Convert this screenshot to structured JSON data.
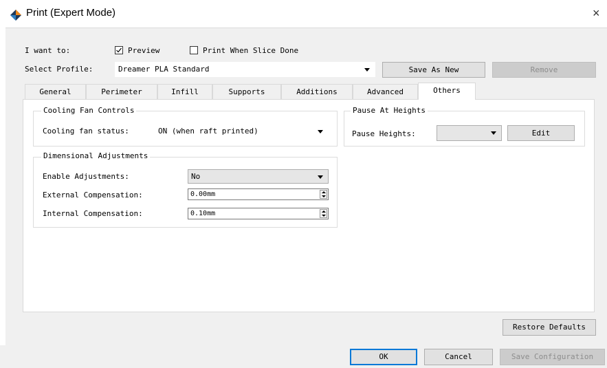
{
  "window": {
    "title": "Print (Expert Mode)",
    "close_glyph": "×",
    "icon": "diamond-logo-icon"
  },
  "top": {
    "i_want_to_label": "I want to:",
    "preview_label": "Preview",
    "preview_checked": true,
    "print_when_slice_done_label": "Print When Slice Done",
    "print_when_slice_done_checked": false
  },
  "profile": {
    "label": "Select Profile:",
    "value": "Dreamer PLA Standard",
    "save_as_new_label": "Save As New",
    "remove_label": "Remove"
  },
  "tabs": [
    {
      "label": "General",
      "active": false
    },
    {
      "label": "Perimeter",
      "active": false
    },
    {
      "label": "Infill",
      "active": false
    },
    {
      "label": "Supports",
      "active": false
    },
    {
      "label": "Additions",
      "active": false
    },
    {
      "label": "Advanced",
      "active": false
    },
    {
      "label": "Others",
      "active": true
    }
  ],
  "cooling": {
    "group_title": "Cooling Fan Controls",
    "status_label": "Cooling fan status:",
    "status_value": "ON (when raft printed)"
  },
  "dimensional": {
    "group_title": "Dimensional Adjustments",
    "enable_label": "Enable Adjustments:",
    "enable_value": "No",
    "external_label": "External Compensation:",
    "external_value": "0.00mm",
    "internal_label": "Internal Compensation:",
    "internal_value": "0.10mm"
  },
  "pause": {
    "group_title": "Pause At Heights",
    "heights_label": "Pause Heights:",
    "heights_value": "",
    "edit_label": "Edit"
  },
  "restore_defaults_label": "Restore Defaults",
  "footer": {
    "ok_label": "OK",
    "cancel_label": "Cancel",
    "save_configuration_label": "Save Configuration"
  },
  "colors": {
    "accent": "#0078d7",
    "dialog_bg": "#f0f0f0",
    "panel_bg": "#ffffff"
  }
}
